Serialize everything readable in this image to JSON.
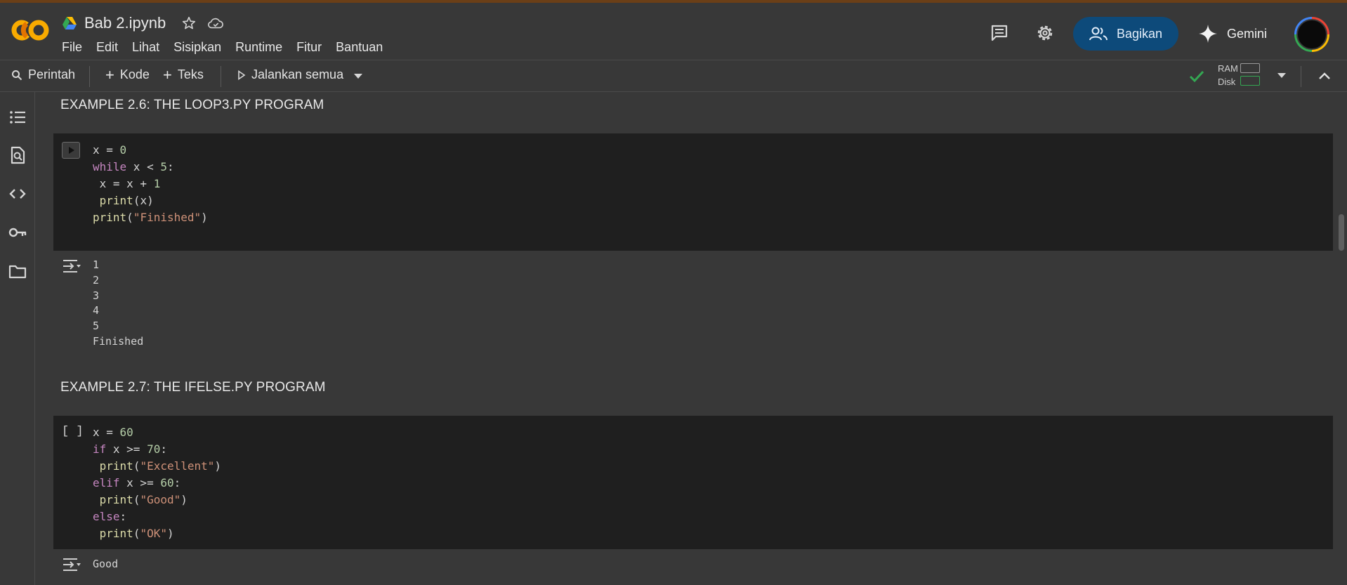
{
  "header": {
    "notebook_title": "Bab 2.ipynb",
    "menu": [
      "File",
      "Edit",
      "Lihat",
      "Sisipkan",
      "Runtime",
      "Fitur",
      "Bantuan"
    ],
    "share_label": "Bagikan",
    "gemini_label": "Gemini"
  },
  "toolbar": {
    "search_label": "Perintah",
    "add_code_label": "Kode",
    "add_text_label": "Teks",
    "run_all_label": "Jalankan semua",
    "ram_label": "RAM",
    "disk_label": "Disk"
  },
  "cells": [
    {
      "heading": "EXAMPLE 2.6: THE LOOP3.PY PROGRAM",
      "run_indicator": "[ ]",
      "code": [
        "x = 0",
        "while x < 5:",
        " x = x + 1",
        " print(x)",
        "print(\"Finished\")"
      ],
      "output": [
        "1",
        "2",
        "3",
        "4",
        "5",
        "Finished"
      ]
    },
    {
      "heading": "EXAMPLE 2.7: THE IFELSE.PY PROGRAM",
      "run_indicator": "[ ]",
      "code": [
        "x = 60",
        "if x >= 70:",
        " print(\"Excellent\")",
        "elif x >= 60:",
        " print(\"Good\")",
        "else:",
        " print(\"OK\")"
      ],
      "output": [
        "Good"
      ]
    }
  ],
  "colors": {
    "background": "#383838",
    "cell_background": "#1f1f1f",
    "share_button": "#0d4a7a",
    "keyword": "#c586c0",
    "function": "#dcdcaa",
    "string": "#ce9178",
    "number": "#b5cea8",
    "check": "#34a853"
  },
  "icons": {
    "rail": [
      "toc-icon",
      "find-replace-icon",
      "code-snippets-icon",
      "secrets-key-icon",
      "files-folder-icon"
    ],
    "header": [
      "drive-icon",
      "star-icon",
      "cloud-icon",
      "comment-icon",
      "settings-gear-icon",
      "share-people-icon",
      "gemini-sparkle-icon"
    ]
  }
}
